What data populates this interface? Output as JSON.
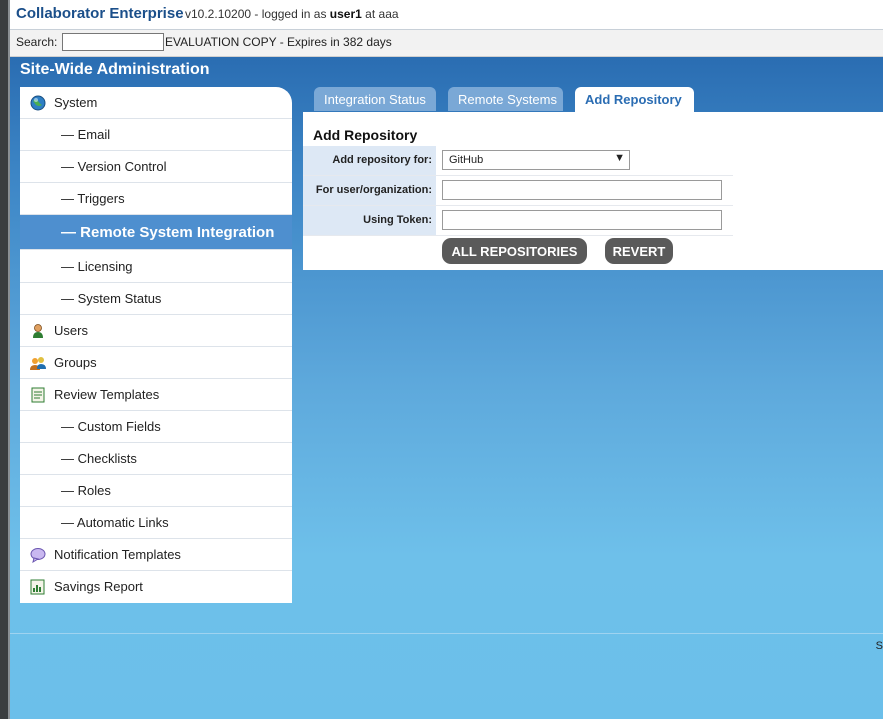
{
  "header": {
    "app_title": "Collaborator Enterprise",
    "version_prefix": "v10.2.10200 - logged in as",
    "user": "user1",
    "version_suffix": "at aaa"
  },
  "searchbar": {
    "label": "Search:",
    "value": "",
    "evaluation": "EVALUATION COPY - Expires in 382 days"
  },
  "main": {
    "section_title": "Site-Wide Administration",
    "corner_text": "S"
  },
  "sidebar": {
    "items": [
      {
        "label": "System",
        "icon": "globe-icon"
      },
      {
        "label": "— Email"
      },
      {
        "label": "— Version Control"
      },
      {
        "label": "— Triggers"
      },
      {
        "label": "— Remote System Integration",
        "active": true
      },
      {
        "label": "— Licensing"
      },
      {
        "label": "— System Status"
      },
      {
        "label": "Users",
        "icon": "user-icon"
      },
      {
        "label": "Groups",
        "icon": "groups-icon"
      },
      {
        "label": "Review Templates",
        "icon": "template-icon"
      },
      {
        "label": "— Custom Fields"
      },
      {
        "label": "— Checklists"
      },
      {
        "label": "— Roles"
      },
      {
        "label": "— Automatic Links"
      },
      {
        "label": "Notification Templates",
        "icon": "speech-bubble-icon"
      },
      {
        "label": "Savings Report",
        "icon": "report-icon"
      }
    ]
  },
  "tabs": [
    {
      "label": "Integration Status"
    },
    {
      "label": "Remote Systems"
    },
    {
      "label": "Add Repository",
      "active": true
    }
  ],
  "form": {
    "title": "Add Repository",
    "add_repo_for_label": "Add repository for:",
    "add_repo_for_value": "GitHub",
    "user_org_label": "For user/organization:",
    "user_org_value": "",
    "token_label": "Using Token:",
    "token_value": "",
    "all_repos_button": "ALL REPOSITORIES",
    "revert_button": "REVERT"
  },
  "colors": {
    "header_title": "#1b4f8a",
    "main_bg_top": "#2a6db2",
    "main_bg_bottom": "#6bbfea",
    "sidebar_active": "#4e8fcf",
    "tab_inactive": "#7aa8d6",
    "button": "#5a5a5a"
  }
}
